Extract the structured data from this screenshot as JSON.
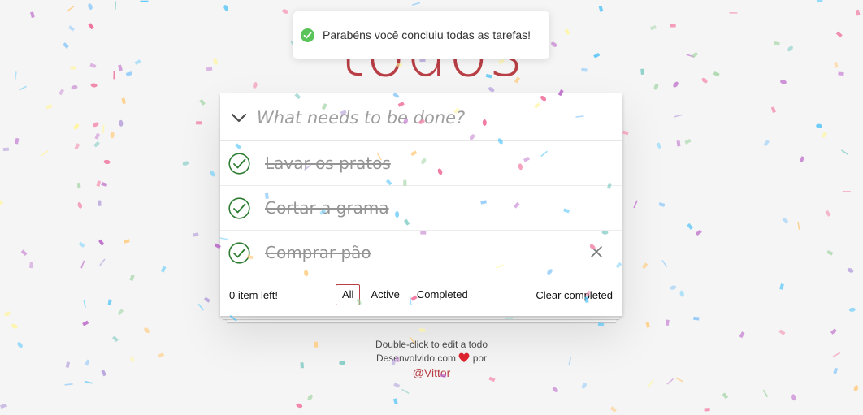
{
  "app": {
    "title": "todos"
  },
  "toast": {
    "message": "Parabéns você concluiu todas as tarefas!"
  },
  "new_todo": {
    "placeholder": "What needs to be done?",
    "value": ""
  },
  "todos": [
    {
      "label": "Lavar os pratos",
      "completed": true
    },
    {
      "label": "Cortar a grama",
      "completed": true
    },
    {
      "label": "Comprar pão",
      "completed": true
    }
  ],
  "footer": {
    "count_text": "0 item left!",
    "filters": [
      {
        "label": "All",
        "selected": true
      },
      {
        "label": "Active",
        "selected": false
      },
      {
        "label": "Completed",
        "selected": false
      }
    ],
    "clear_label": "Clear completed"
  },
  "info": {
    "hint": "Double-click to edit a todo",
    "credit_prefix": "Desenvolvido com",
    "credit_suffix": "por",
    "author": "@Vittor"
  },
  "colors": {
    "accent": "#b83f45",
    "check": "#2e7d32",
    "toast_icon": "#5ac45a"
  }
}
